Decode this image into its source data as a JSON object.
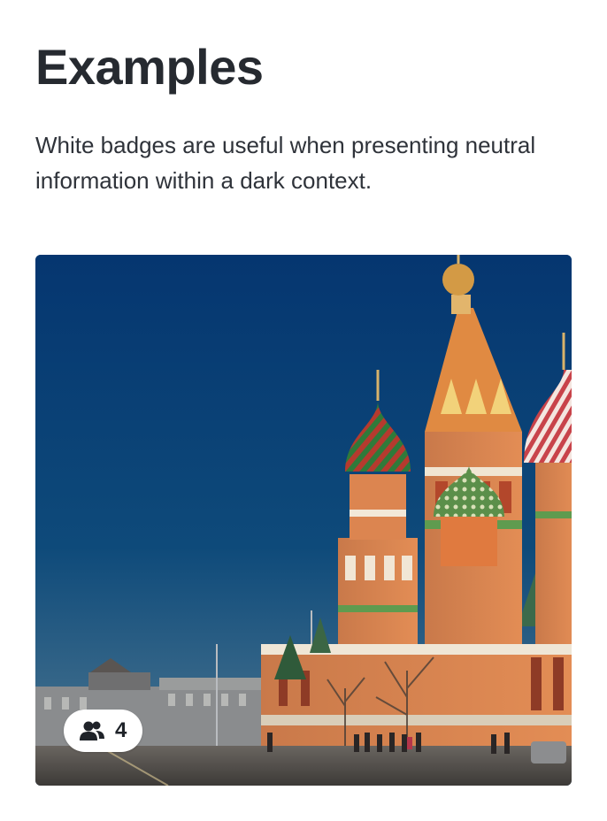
{
  "heading": "Examples",
  "description": "White badges are useful when presenting neutral information within a dark context.",
  "card": {
    "image_subject": "Saint Basil's Cathedral under a blue sky",
    "badge": {
      "icon": "users-icon",
      "count": "4"
    }
  },
  "colors": {
    "sky_top": "#063a73",
    "sky_bottom": "#2c5f86",
    "badge_bg": "#ffffff",
    "text": "#262a30"
  }
}
